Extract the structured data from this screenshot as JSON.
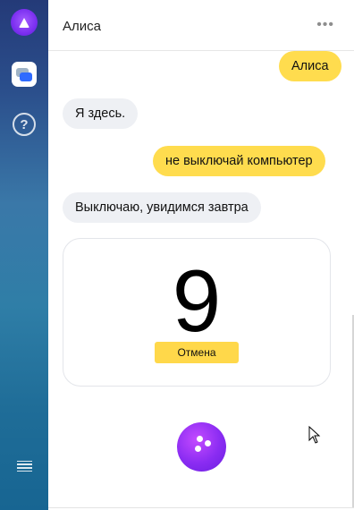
{
  "app": {
    "title": "Алиса",
    "more_label": "•••"
  },
  "sidebar": {
    "items": [
      {
        "name": "alice-logo-icon"
      },
      {
        "name": "chat-icon"
      },
      {
        "name": "help-icon",
        "label": "?"
      },
      {
        "name": "grid-icon"
      },
      {
        "name": "menu-icon"
      }
    ]
  },
  "messages": [
    {
      "role": "user",
      "text": "Алиса"
    },
    {
      "role": "assistant",
      "text": "Я здесь."
    },
    {
      "role": "user",
      "text": "не выключай компьютер"
    },
    {
      "role": "assistant",
      "text": "Выключаю, увидимся завтра"
    }
  ],
  "timer_card": {
    "countdown": "9",
    "cancel_label": "Отмена"
  },
  "colors": {
    "accent": "#ffdc4e",
    "bot_bubble": "#eef0f4",
    "mic": "#8a2cf2"
  }
}
